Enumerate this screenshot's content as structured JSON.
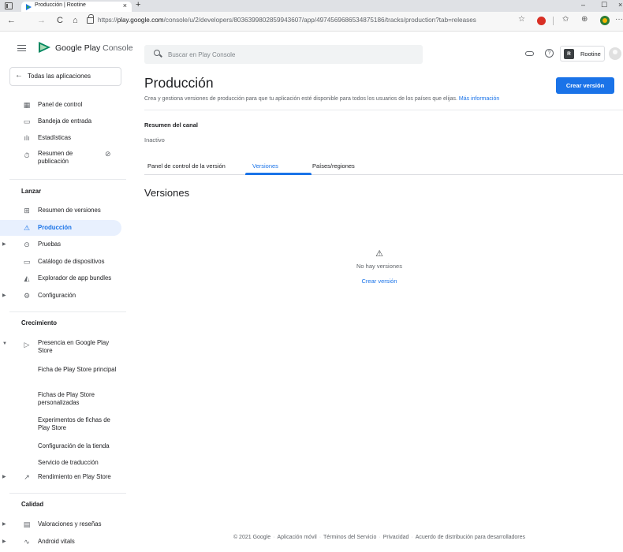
{
  "browser": {
    "tab_title": "Producción | Rootine",
    "tab_close": "×",
    "new_tab": "+",
    "url_prefix": "https://",
    "url_domain": "play.google.com",
    "url_path": "/console/u/2/developers/8036399802859943607/app/4974569686534875186/tracks/production?tab=releases",
    "min": "–",
    "max": "☐",
    "close": "×",
    "back": "←",
    "forward": "→",
    "reload": "C",
    "home": "⌂",
    "more": "···"
  },
  "header": {
    "brand": "Google Play",
    "brand_suffix": "Console",
    "search_placeholder": "Buscar en Play Console",
    "help": "?",
    "account_initial": "R",
    "account_name": "Rootine"
  },
  "sidebar": {
    "back_label": "Todas las aplicaciones",
    "items": [
      {
        "label": "Panel de control",
        "icon": "dashboard-icon"
      },
      {
        "label": "Bandeja de entrada",
        "icon": "inbox-icon"
      },
      {
        "label": "Estadísticas",
        "icon": "stats-icon"
      },
      {
        "label": "Resumen de publicación",
        "icon": "publishing-overview-icon"
      }
    ],
    "section_launch": "Lanzar",
    "launch_items": [
      {
        "label": "Resumen de versiones"
      },
      {
        "label": "Producción"
      },
      {
        "label": "Pruebas"
      },
      {
        "label": "Catálogo de dispositivos"
      },
      {
        "label": "Explorador de app bundles"
      },
      {
        "label": "Configuración"
      }
    ],
    "section_growth": "Crecimiento",
    "growth_presence": "Presencia en Google Play Store",
    "growth_subitems": [
      {
        "label": "Ficha de Play Store principal"
      },
      {
        "label": "Fichas de Play Store personalizadas"
      },
      {
        "label": "Experimentos de fichas de Play Store"
      },
      {
        "label": "Configuración de la tienda"
      },
      {
        "label": "Servicio de traducción"
      }
    ],
    "growth_performance": "Rendimiento en Play Store",
    "section_quality": "Calidad",
    "quality_items": [
      {
        "label": "Valoraciones y reseñas"
      },
      {
        "label": "Android vitals"
      }
    ]
  },
  "main": {
    "title": "Producción",
    "subtitle": "Crea y gestiona versiones de producción para que tu aplicación esté disponible para todos los usuarios de los países que elijas.",
    "more_info": "Más información",
    "create_button": "Crear versión",
    "channel_summary": "Resumen del canal",
    "channel_status": "Inactivo",
    "tabs": [
      {
        "label": "Panel de control de la versión"
      },
      {
        "label": "Versiones"
      },
      {
        "label": "Países/regiones"
      }
    ],
    "section_heading": "Versiones",
    "empty_text": "No hay versiones",
    "empty_link": "Crear versión"
  },
  "footer": {
    "copyright": "© 2021 Google",
    "links": [
      "Aplicación móvil",
      "Términos del Servicio",
      "Privacidad",
      "Acuerdo de distribución para desarrolladores"
    ]
  },
  "colors": {
    "accent": "#1a73e8",
    "active_bg": "#e8f0fe",
    "text": "#202124",
    "muted": "#5f6368"
  }
}
